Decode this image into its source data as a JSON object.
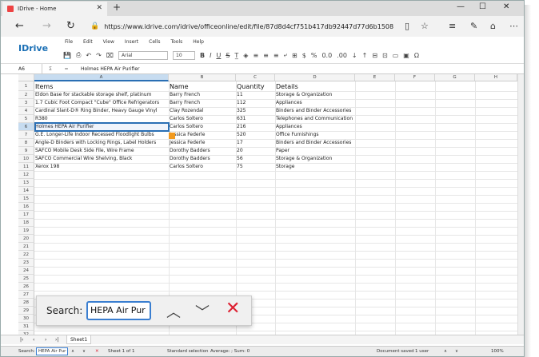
{
  "browser": {
    "tab_title": "IDrive - Home",
    "url": "https://www.idrive.com/idrive/officeonline/edit/file/87d8d4cf751b417db92447d77d6b1508"
  },
  "app": {
    "logo": "IDrive",
    "menu": [
      "File",
      "Edit",
      "View",
      "Insert",
      "Cells",
      "Tools",
      "Help"
    ],
    "font_name": "Arial",
    "font_size": "10",
    "cell_ref": "A6",
    "formula_value": "Holmes HEPA Air Purifier"
  },
  "columns": [
    "A",
    "B",
    "C",
    "D",
    "E",
    "F",
    "G",
    "H"
  ],
  "headers": [
    "Items",
    "Name",
    "Quantity",
    "Details"
  ],
  "rows": [
    [
      "Eldon Base for stackable storage shelf, platinum",
      "Barry French",
      "11",
      "Storage & Organization"
    ],
    [
      "1.7 Cubic Foot Compact \"Cube\" Office Refrigerators",
      "Barry French",
      "112",
      "Appliances"
    ],
    [
      "Cardinal Slant-D® Ring Binder, Heavy Gauge Vinyl",
      "Clay Rozendal",
      "325",
      "Binders and Binder Accessories"
    ],
    [
      "R380",
      "Carlos Soltero",
      "631",
      "Telephones and Communication"
    ],
    [
      "Holmes HEPA Air Purifier",
      "Carlos Soltero",
      "216",
      "Appliances"
    ],
    [
      "G.E. Longer-Life Indoor Recessed Floodlight Bulbs",
      "Jessica Federle",
      "520",
      "Office Furnishings"
    ],
    [
      "Angle-D Binders with Locking Rings, Label Holders",
      "Jessica Federle",
      "17",
      "Binders and Binder Accessories"
    ],
    [
      "SAFCO Mobile Desk Side File, Wire Frame",
      "Dorothy Badders",
      "20",
      "Paper"
    ],
    [
      "SAFCO Commercial Wire Shelving, Black",
      "Dorothy Badders",
      "56",
      "Storage & Organization"
    ],
    [
      "Xerox 198",
      "Carlos Soltero",
      "75",
      "Storage"
    ]
  ],
  "row_numbers": [
    "1",
    "2",
    "3",
    "4",
    "5",
    "6",
    "7",
    "8",
    "9",
    "10",
    "11",
    "12",
    "13",
    "14",
    "15",
    "16",
    "17",
    "18",
    "19",
    "20",
    "21",
    "22",
    "23",
    "24",
    "25",
    "26",
    "27",
    "28",
    "29",
    "30",
    "31",
    "32"
  ],
  "sheet": {
    "tab": "Sheet1"
  },
  "status": {
    "search_label": "Search:",
    "search_value": "HEPA Air Pur",
    "sheet_info": "Sheet 1 of 1",
    "selection_mode": "Standard selection",
    "summary": "Average: ; Sum: 0",
    "doc_state": "Document saved",
    "users": "1 user",
    "zoom": "100%"
  },
  "findbar": {
    "label": "Search:",
    "value": "HEPA Air Pur"
  }
}
